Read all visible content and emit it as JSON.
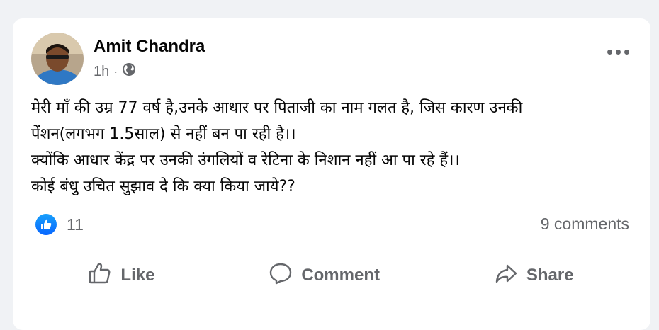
{
  "post": {
    "author": "Amit Chandra",
    "time": "1h",
    "separator": "·",
    "audience_icon": "globe-icon",
    "lines": [
      "मेरी माँ की उम्र 77 वर्ष है,उनके आधार पर पिताजी का नाम गलत है, जिस कारण उनकी",
      "पेंशन(लगभग 1.5साल) से नहीं बन पा रही है।।",
      "क्योंकि आधार केंद्र पर उनकी उंगलियों व रेटिना के निशान नहीं आ पा रहे हैं।।",
      "कोई बंधु उचित सुझाव दे कि क्या किया जाये??"
    ]
  },
  "stats": {
    "reaction_count": "11",
    "comments": "9 comments"
  },
  "actions": {
    "like": "Like",
    "comment": "Comment",
    "share": "Share"
  },
  "colors": {
    "accent": "#0866ff",
    "muted_text": "#65676b",
    "background": "#f0f2f5"
  }
}
